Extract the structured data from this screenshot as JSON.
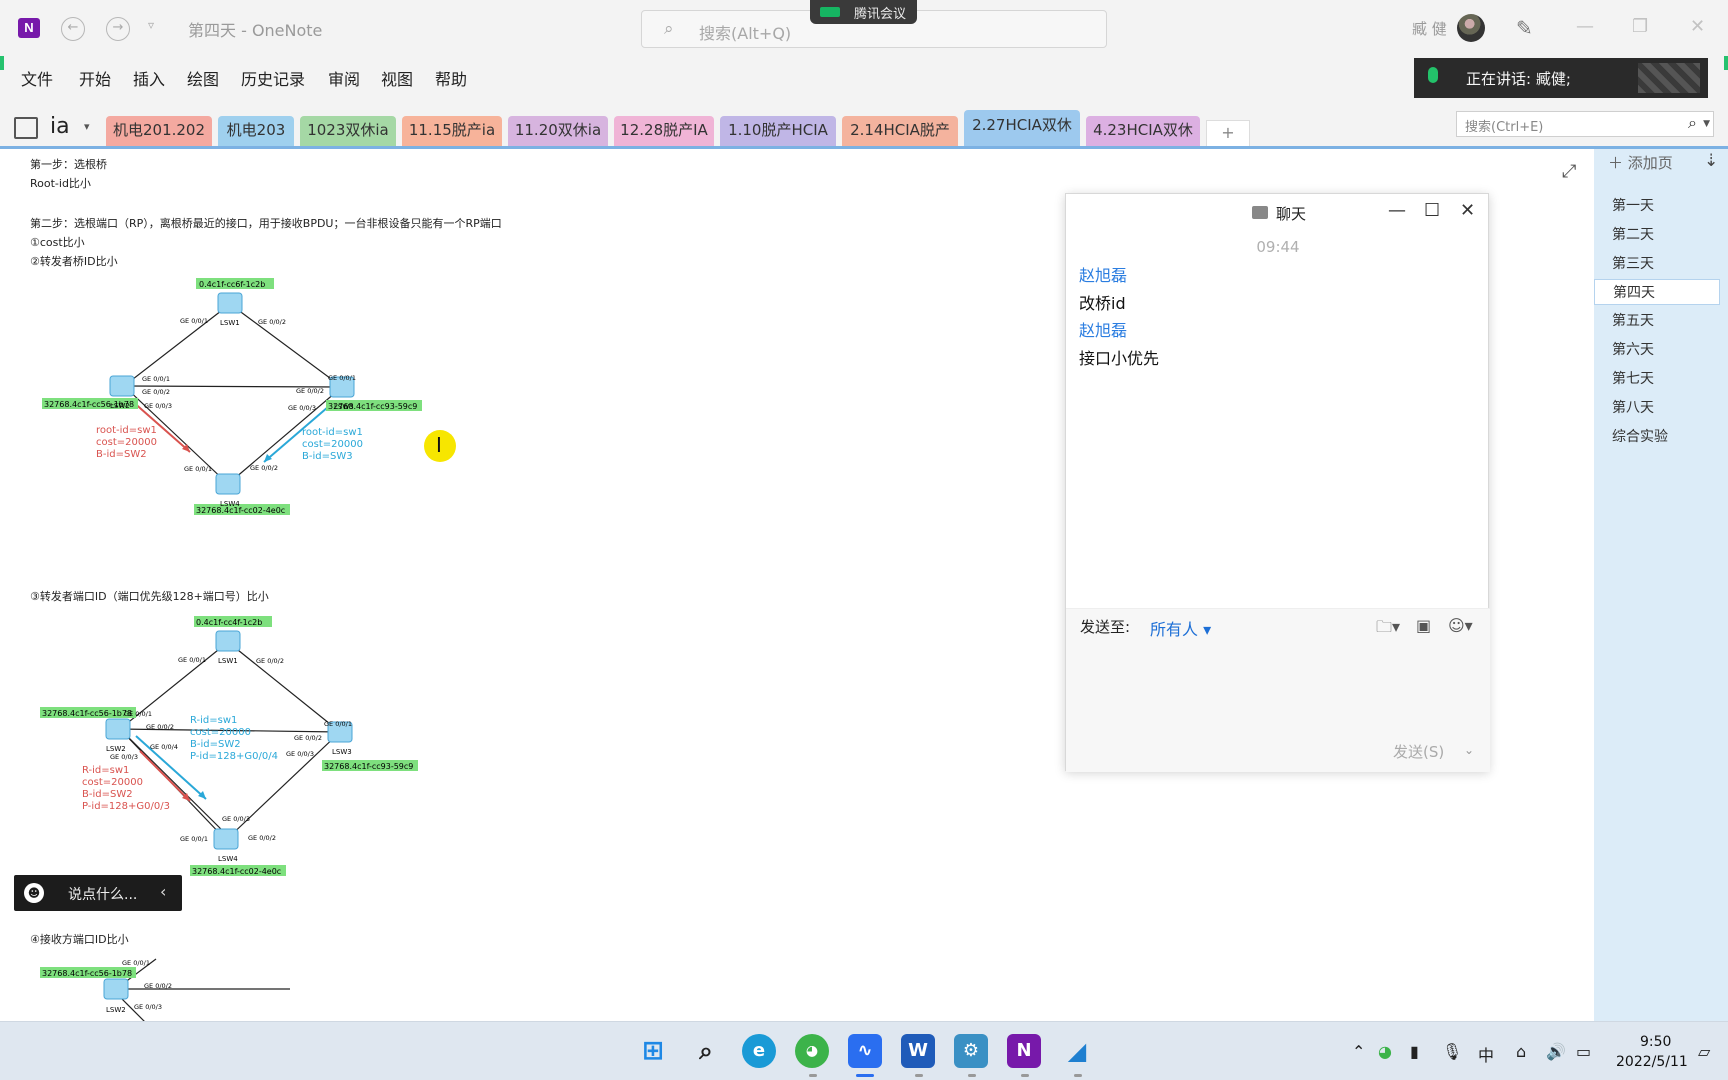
{
  "titlebar": {
    "app_icon": "N",
    "title": "第四天 - OneNote",
    "search_placeholder": "搜索(Alt+Q)",
    "meeting_app": "腾讯会议",
    "user_name": "臧 健",
    "icons": [
      "back-icon",
      "forward-icon",
      "pen-icon",
      "minimize-icon",
      "restore-icon",
      "close-icon"
    ]
  },
  "menu": [
    "文件",
    "开始",
    "插入",
    "绘图",
    "历史记录",
    "审阅",
    "视图",
    "帮助"
  ],
  "speaking": {
    "label": "正在讲话: 臧健;"
  },
  "notebook": {
    "name": "ia"
  },
  "sections": [
    {
      "label": "机电201.202",
      "color": "#f4a9a0"
    },
    {
      "label": "机电203",
      "color": "#9fd0ee"
    },
    {
      "label": "1023双休ia",
      "color": "#a5d8a5"
    },
    {
      "label": "11.15脱产ia",
      "color": "#f7b39a"
    },
    {
      "label": "11.20双休ia",
      "color": "#d7b4df"
    },
    {
      "label": "12.28脱产IA",
      "color": "#f0b4d6"
    },
    {
      "label": "1.10脱产HCIA",
      "color": "#c0b6e6"
    },
    {
      "label": "2.14HCIA脱产",
      "color": "#f4b39e"
    },
    {
      "label": "2.27HCIA双休",
      "color": "#9dc9ee"
    },
    {
      "label": "4.23HCIA双休",
      "color": "#dcb0e2"
    }
  ],
  "page_search_placeholder": "搜索(Ctrl+E)",
  "add_page_label": "添加页",
  "pages": [
    "第一天",
    "第二天",
    "第三天",
    "第四天",
    "第五天",
    "第六天",
    "第七天",
    "第八天",
    "综合实验"
  ],
  "note": {
    "step1": "第一步：选根桥",
    "step1_rule": "Root-id比小",
    "step2": "第二步：选根端口（RP），离根桥最近的接口，用于接收BPDU；一台非根设备只能有一个RP端口",
    "rule1": "①cost比小",
    "rule2": "②转发者桥ID比小",
    "rule3": "③转发者端口ID（端口优先级128+端口号）比小",
    "rule4": "④接收方端口ID比小"
  },
  "diagram1": {
    "sw1_id": "0.4c1f-cc6f-1c2b",
    "sw2_id": "32768.4c1f-cc56-1b78",
    "sw3_id": "32768.4c1f-cc93-59c9",
    "sw4_id": "32768.4c1f-cc02-4e0c",
    "sw_labels": [
      "LSW1",
      "LSW2",
      "LSW3",
      "LSW4"
    ],
    "ports": [
      "GE 0/0/1",
      "GE 0/0/2",
      "GE 0/0/1",
      "GE 0/0/2",
      "GE 0/0/3",
      "GE 0/0/2",
      "GE 0/0/1",
      "GE 0/0/3",
      "GE 0/0/1",
      "GE 0/0/2"
    ],
    "red_note": [
      "root-id=sw1",
      "cost=20000",
      "B-id=SW2"
    ],
    "blue_note": [
      "root-id=sw1",
      "cost=20000",
      "B-id=SW3"
    ]
  },
  "diagram2": {
    "sw1_id": "0.4c1f-cc4f-1c2b",
    "sw2_id": "32768.4c1f-cc56-1b78",
    "sw3_id": "32768.4c1f-cc93-59c9",
    "sw4_id": "32768.4c1f-cc02-4e0c",
    "sw_labels": [
      "LSW1",
      "LSW2",
      "LSW3",
      "LSW4"
    ],
    "ports": [
      "GE 0/0/1",
      "GE 0/0/2",
      "GE 0/0/1",
      "GE 0/0/2",
      "GE 0/0/4",
      "GE 0/0/3",
      "GE 0/0/1",
      "GE 0/0/2",
      "GE 0/0/3",
      "GE 0/0/3",
      "GE 0/0/1",
      "GE 0/0/2"
    ],
    "blue_note": [
      "R-id=sw1",
      "cost=20000",
      "B-id=SW2",
      "P-id=128+G0/0/4"
    ],
    "red_note": [
      "R-id=sw1",
      "cost=20000",
      "B-id=SW2",
      "P-id=128+G0/0/3"
    ]
  },
  "diagram3": {
    "sw2_id": "32768.4c1f-cc56-1b78",
    "sw_label": "LSW2",
    "ports": [
      "GE 0/0/1",
      "GE 0/0/2",
      "GE 0/0/3"
    ]
  },
  "chat": {
    "title": "聊天",
    "time": "09:44",
    "messages": [
      {
        "sender": "赵旭磊",
        "text": "改桥id"
      },
      {
        "sender": "赵旭磊",
        "text": "接口小优先"
      }
    ],
    "send_to_label": "发送至:",
    "send_to_value": "所有人",
    "send_button": "发送(S)"
  },
  "say_bar": {
    "label": "说点什么..."
  },
  "taskbar": {
    "apps": [
      "start-icon",
      "search-icon",
      "edge-icon",
      "wechat-icon",
      "tencent-meeting-icon",
      "word-icon",
      "tool-icon",
      "onenote-icon",
      "wireshark-icon"
    ],
    "ime": "中",
    "time": "9:50",
    "date": "2022/5/11"
  },
  "colors": {
    "accent_blue": "#2b7de0",
    "share_green": "#25c26e",
    "label_green": "#7ee07e",
    "note_red": "#d9534f",
    "note_blue": "#2aa8d8"
  }
}
